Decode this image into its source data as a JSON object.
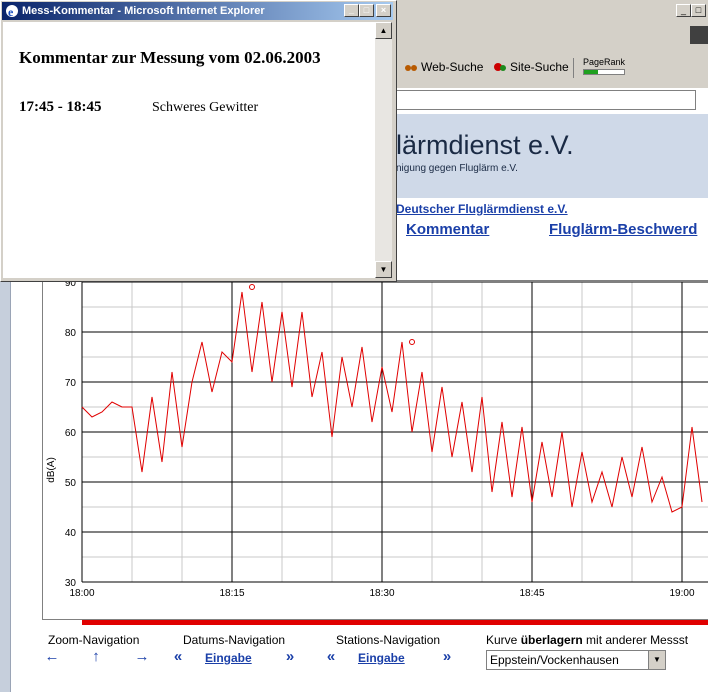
{
  "popup": {
    "title": "Mess-Kommentar - Microsoft Internet Explorer",
    "heading": "Kommentar zur Messung vom 02.06.2003",
    "time": "17:45 - 18:45",
    "comment": "Schweres Gewitter"
  },
  "browser": {
    "toolbar": {
      "web_search": "Web-Suche",
      "site_search": "Site-Suche",
      "pagerank": "PageRank",
      "pagerank_level": 0.35
    }
  },
  "site": {
    "brand": "lärmdienst e.V.",
    "brand_sub": "nigung gegen Fluglärm e.V.",
    "org_link": "Deutscher Fluglärmdienst e.V.",
    "nav": {
      "kommentar": "Kommentar",
      "beschwerde": "Fluglärm-Beschwerd"
    }
  },
  "chart_data": {
    "type": "line",
    "ylabel": "dB(A)",
    "xlabel": "",
    "ylim": [
      30,
      90
    ],
    "y_ticks": [
      "30",
      "40",
      "50",
      "60",
      "70",
      "80",
      "90"
    ],
    "x_ticks": [
      "18:00",
      "18:15",
      "18:30",
      "18:45",
      "19:00"
    ],
    "grid": true,
    "series": [
      {
        "color": "#e00000",
        "x": [
          "18:00",
          "18:01",
          "18:02",
          "18:03",
          "18:04",
          "18:05",
          "18:06",
          "18:07",
          "18:08",
          "18:09",
          "18:10",
          "18:11",
          "18:12",
          "18:13",
          "18:14",
          "18:15",
          "18:16",
          "18:17",
          "18:18",
          "18:19",
          "18:20",
          "18:21",
          "18:22",
          "18:23",
          "18:24",
          "18:25",
          "18:26",
          "18:27",
          "18:28",
          "18:29",
          "18:30",
          "18:31",
          "18:32",
          "18:33",
          "18:34",
          "18:35",
          "18:36",
          "18:37",
          "18:38",
          "18:39",
          "18:40",
          "18:41",
          "18:42",
          "18:43",
          "18:44",
          "18:45",
          "18:46",
          "18:47",
          "18:48",
          "18:49",
          "18:50",
          "18:51",
          "18:52",
          "18:53",
          "18:54",
          "18:55",
          "18:56",
          "18:57",
          "18:58",
          "18:59",
          "19:00",
          "19:01",
          "19:02"
        ],
        "y": [
          65,
          63,
          64,
          66,
          65,
          65,
          52,
          67,
          54,
          72,
          57,
          70,
          78,
          68,
          76,
          74,
          88,
          72,
          86,
          70,
          84,
          69,
          84,
          67,
          76,
          59,
          75,
          65,
          77,
          62,
          73,
          64,
          78,
          60,
          72,
          56,
          69,
          55,
          66,
          52,
          67,
          48,
          62,
          47,
          61,
          46,
          58,
          47,
          60,
          45,
          56,
          46,
          52,
          45,
          55,
          47,
          57,
          46,
          51,
          44,
          45,
          61,
          46
        ]
      }
    ],
    "markers": [
      {
        "x": "18:17",
        "y": 89
      },
      {
        "x": "18:33",
        "y": 78
      }
    ]
  },
  "navigation": {
    "zoom_label": "Zoom-Navigation",
    "date_label": "Datums-Navigation",
    "station_label": "Stations-Navigation",
    "overlay_prefix": "Kurve ",
    "overlay_bold": "überlagern",
    "overlay_suffix": " mit anderer Messst",
    "left_arrow": "←",
    "up_arrow": "↑",
    "right_arrow": "→",
    "back": "«",
    "forward": "»",
    "date_input": "Eingabe",
    "station_input": "Eingabe",
    "station_select": "Eppstein/Vockenhausen"
  }
}
